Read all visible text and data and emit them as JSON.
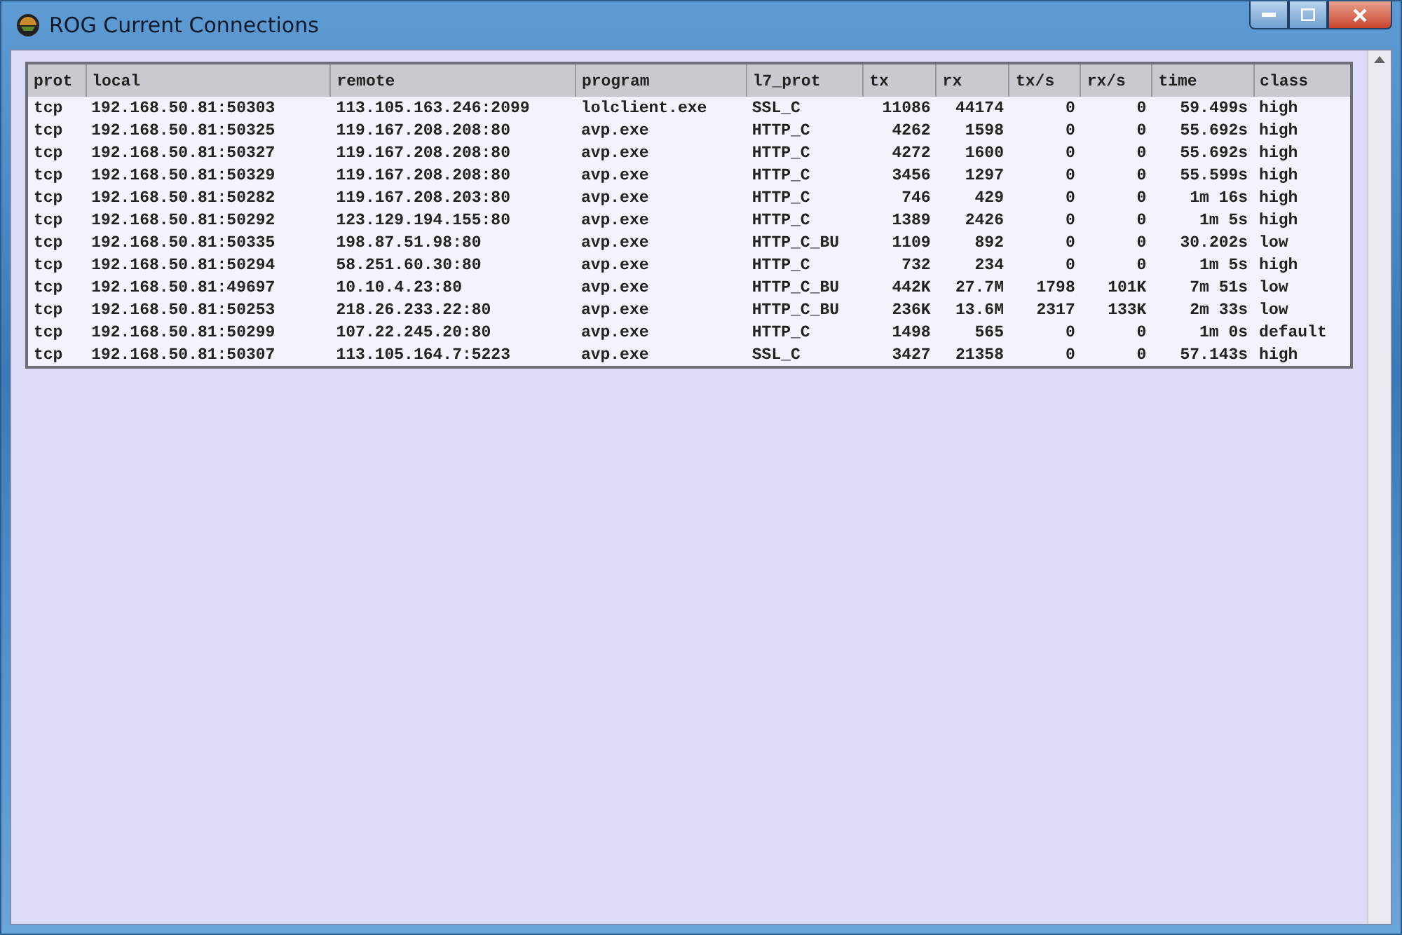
{
  "window": {
    "title": "ROG Current Connections"
  },
  "table": {
    "columns": [
      {
        "label": "prot",
        "kind": "text"
      },
      {
        "label": "local",
        "kind": "text"
      },
      {
        "label": "remote",
        "kind": "text"
      },
      {
        "label": "program",
        "kind": "text"
      },
      {
        "label": "l7_prot",
        "kind": "text"
      },
      {
        "label": "tx",
        "kind": "number"
      },
      {
        "label": "rx",
        "kind": "number"
      },
      {
        "label": "tx/s",
        "kind": "number"
      },
      {
        "label": "rx/s",
        "kind": "number"
      },
      {
        "label": "time",
        "kind": "number"
      },
      {
        "label": "class",
        "kind": "text"
      }
    ],
    "rows": [
      [
        "tcp",
        "192.168.50.81:50303",
        "113.105.163.246:2099",
        "lolclient.exe",
        "SSL_C",
        "11086",
        "44174",
        "0",
        "0",
        "59.499s",
        "high"
      ],
      [
        "tcp",
        "192.168.50.81:50325",
        "119.167.208.208:80",
        "avp.exe",
        "HTTP_C",
        "4262",
        "1598",
        "0",
        "0",
        "55.692s",
        "high"
      ],
      [
        "tcp",
        "192.168.50.81:50327",
        "119.167.208.208:80",
        "avp.exe",
        "HTTP_C",
        "4272",
        "1600",
        "0",
        "0",
        "55.692s",
        "high"
      ],
      [
        "tcp",
        "192.168.50.81:50329",
        "119.167.208.208:80",
        "avp.exe",
        "HTTP_C",
        "3456",
        "1297",
        "0",
        "0",
        "55.599s",
        "high"
      ],
      [
        "tcp",
        "192.168.50.81:50282",
        "119.167.208.203:80",
        "avp.exe",
        "HTTP_C",
        "746",
        "429",
        "0",
        "0",
        "1m 16s",
        "high"
      ],
      [
        "tcp",
        "192.168.50.81:50292",
        "123.129.194.155:80",
        "avp.exe",
        "HTTP_C",
        "1389",
        "2426",
        "0",
        "0",
        "1m 5s",
        "high"
      ],
      [
        "tcp",
        "192.168.50.81:50335",
        "198.87.51.98:80",
        "avp.exe",
        "HTTP_C_BU",
        "1109",
        "892",
        "0",
        "0",
        "30.202s",
        "low"
      ],
      [
        "tcp",
        "192.168.50.81:50294",
        "58.251.60.30:80",
        "avp.exe",
        "HTTP_C",
        "732",
        "234",
        "0",
        "0",
        "1m 5s",
        "high"
      ],
      [
        "tcp",
        "192.168.50.81:49697",
        "10.10.4.23:80",
        "avp.exe",
        "HTTP_C_BU",
        "442K",
        "27.7M",
        "1798",
        "101K",
        "7m 51s",
        "low"
      ],
      [
        "tcp",
        "192.168.50.81:50253",
        "218.26.233.22:80",
        "avp.exe",
        "HTTP_C_BU",
        "236K",
        "13.6M",
        "2317",
        "133K",
        "2m 33s",
        "low"
      ],
      [
        "tcp",
        "192.168.50.81:50299",
        "107.22.245.20:80",
        "avp.exe",
        "HTTP_C",
        "1498",
        "565",
        "0",
        "0",
        "1m 0s",
        "default"
      ],
      [
        "tcp",
        "192.168.50.81:50307",
        "113.105.164.7:5223",
        "avp.exe",
        "SSL_C",
        "3427",
        "21358",
        "0",
        "0",
        "57.143s",
        "high"
      ]
    ]
  }
}
